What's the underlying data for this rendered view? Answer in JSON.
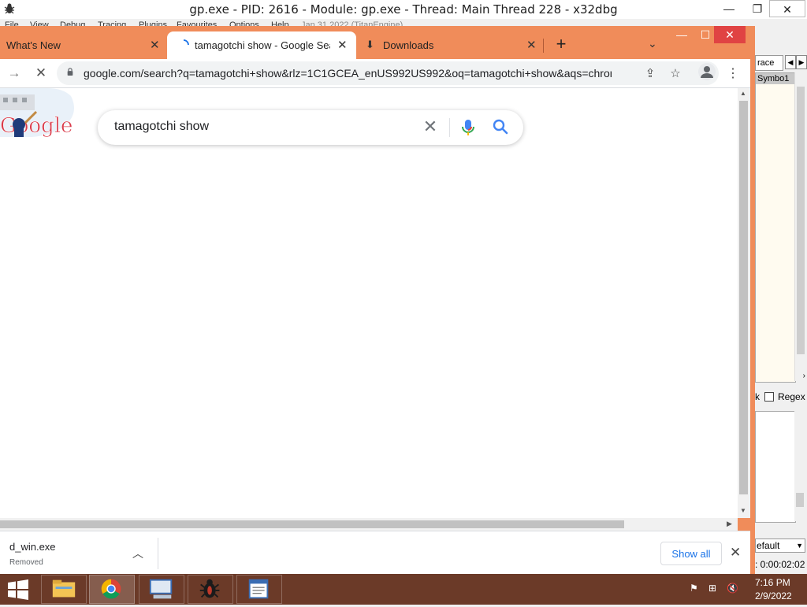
{
  "debugger": {
    "title": "gp.exe - PID: 2616 - Module: gp.exe - Thread: Main Thread 228 - x32dbg",
    "menu": [
      "File",
      "View",
      "Debug",
      "Tracing",
      "Plugins",
      "Favourites",
      "Options",
      "Help",
      "Jan 31 2022 (TitanEngine)"
    ],
    "window_buttons": {
      "minimize": "—",
      "restore": "❐",
      "close": "✕"
    },
    "right_panel": {
      "tab_label": "race",
      "pane_header": "Symbo1",
      "regex_label": "Regex",
      "combo_value": "efault",
      "timer": ": 0:00:02:02",
      "left_mark": "k"
    }
  },
  "chrome": {
    "tabs": [
      {
        "label": "What's New",
        "active": false
      },
      {
        "label": "tamagotchi show - Google Searc",
        "active": true
      },
      {
        "label": "Downloads",
        "active": false
      }
    ],
    "new_tab": "+",
    "tab_search": "⌄",
    "window_buttons": {
      "minimize": "—",
      "maximize": "☐",
      "close": "✕"
    },
    "address_bar": {
      "url": "google.com/search?q=tamagotchi+show&rlz=1C1GCEA_enUS992US992&oq=tamagotchi+show&aqs=chrome...."
    },
    "search": {
      "query": "tamagotchi show"
    },
    "download_shelf": {
      "file_name": "d_win.exe",
      "status": "Removed",
      "show_all": "Show all"
    }
  },
  "taskbar": {
    "apps": [
      "file-explorer",
      "chrome",
      "remote-desktop",
      "x32dbg",
      "notepad"
    ],
    "clock_time": "7:16 PM",
    "clock_date": "2/9/2022"
  },
  "colors": {
    "chrome_frame": "#f08c5a",
    "taskbar": "#6b3a28",
    "google_blue": "#4285f4"
  }
}
